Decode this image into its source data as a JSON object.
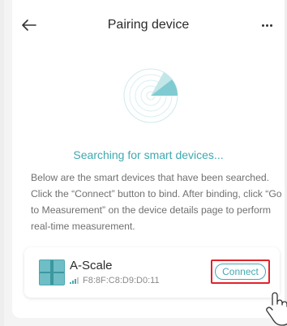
{
  "header": {
    "title": "Pairing device",
    "back_icon": "arrow-left-icon",
    "more_icon": "more-horizontal-icon"
  },
  "search": {
    "status": "Searching for smart devices...",
    "description": "Below are the smart devices that have been searched. Click the “Connect” button to bind. After binding, click “Go to Measurement” on the device details page to perform real-time measurement."
  },
  "device": {
    "name": "A-Scale",
    "mac": "F8:8F:C8:D9:D0:11",
    "connect_label": "Connect"
  },
  "colors": {
    "accent": "#43a9b2",
    "highlight": "#e0232a"
  }
}
